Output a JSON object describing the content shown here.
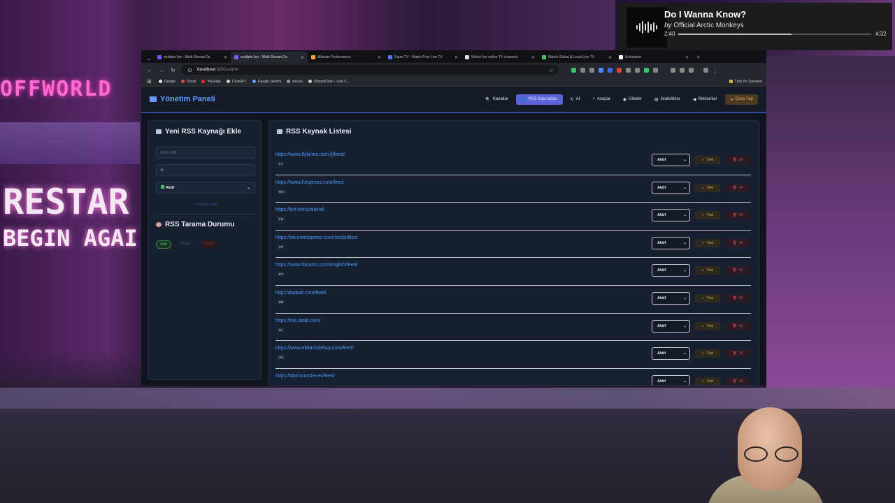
{
  "media": {
    "title": "Do I Wanna Know?",
    "by": "by",
    "artist": "Official Arctic Monkeys",
    "elapsed": "2:40",
    "duration": "4:32",
    "progress": 0.588
  },
  "background": {
    "sign_top": "OFFWORLD",
    "sign_mid": "RESTAR",
    "sign_low": "BEGIN AGAI"
  },
  "browser": {
    "tabs": [
      {
        "label": "mutliple.live - Multi-Stream Da",
        "color": "#7a5af5",
        "active": false
      },
      {
        "label": "mutliple.live - Multi-Stream Da",
        "color": "#7a5af5",
        "active": true
      },
      {
        "label": "Website Performance",
        "color": "#f5a623",
        "active": false
      },
      {
        "label": "Squid TV - Watch Free Live TV",
        "color": "#4a7af5",
        "active": false
      },
      {
        "label": "Watch live online TV channels",
        "color": "#e0e0e0",
        "active": false
      },
      {
        "label": "Watch Global & Local Live TV",
        "color": "#3ac46a",
        "active": false
      },
      {
        "label": "Kickstarter",
        "color": "#ffffff",
        "active": false
      }
    ],
    "url_host": "localhost",
    "url_path": ":3002/admin",
    "bookmarks": [
      {
        "label": "Google",
        "color": "#e8e8e8"
      },
      {
        "label": "Gmail",
        "color": "#e04a3a"
      },
      {
        "label": "YouTube",
        "color": "#ff2a2a"
      },
      {
        "label": "ChatGPT",
        "color": "#d0d0d0"
      },
      {
        "label": "Google Gemini",
        "color": "#7aa0ff"
      },
      {
        "label": "ssssss",
        "color": "#999999"
      },
      {
        "label": "StreamDash - Live S...",
        "color": "#d0d0d0"
      }
    ],
    "bookmarks_all": "Tüm Yer İşaretleri"
  },
  "app": {
    "brand": "Yönetim Paneli",
    "nav": [
      {
        "label": "Kanallar",
        "icon": "🔍",
        "name": "nav-kanallar"
      },
      {
        "label": "RSS Kaynakları",
        "icon": "👤",
        "name": "nav-rss",
        "active": true
      },
      {
        "label": "AI",
        "icon": "↻",
        "name": "nav-ai"
      },
      {
        "label": "Araçlar",
        "icon": "+",
        "name": "nav-araclar"
      },
      {
        "label": "Ülkeler",
        "icon": "◉",
        "name": "nav-ulkeler"
      },
      {
        "label": "İstatistikler",
        "icon": "▤",
        "name": "nav-istatistikler"
      },
      {
        "label": "Reklamlar",
        "icon": "◀",
        "name": "nav-reklamlar"
      },
      {
        "label": "Çıkış Yap",
        "icon": "⇥",
        "name": "nav-logout",
        "logout": true
      }
    ],
    "add_panel": {
      "title": "Yeni RSS Kaynağı Ekle",
      "url_placeholder": "RSS URL",
      "country_value": "tr",
      "status_value": "Aktif",
      "add_button": "Kaynak Ekle"
    },
    "scan_panel": {
      "title": "RSS Tarama Durumu",
      "chips": [
        "Aktif",
        "Başlat",
        "Durdur"
      ]
    },
    "list_panel": {
      "title": "RSS Kaynak Listesi",
      "status_label": "Aktif",
      "test_label": "Test",
      "delete_label": "Sil",
      "rows": [
        {
          "url": "https://www.fijitimes.com.fj/feed/",
          "code": "FJ"
        },
        {
          "url": "https://www.hespress.com/feed",
          "code": "MA"
        },
        {
          "url": "https://kvf.fo/rss/tidindi",
          "code": "FO"
        },
        {
          "url": "https://en.mercopress.com/rss/politics",
          "code": "FK"
        },
        {
          "url": "https://www.fanamc.com/english/feed/",
          "code": "ET"
        },
        {
          "url": "http://shabait.com/feed/",
          "code": "ER"
        },
        {
          "url": "https://rss.detik.com/",
          "code": "ID"
        },
        {
          "url": "https://www.eldiariodehoy.com/feed/",
          "code": "SV"
        },
        {
          "url": "https://diariorombe.es/feed/",
          "code": ""
        }
      ]
    }
  }
}
